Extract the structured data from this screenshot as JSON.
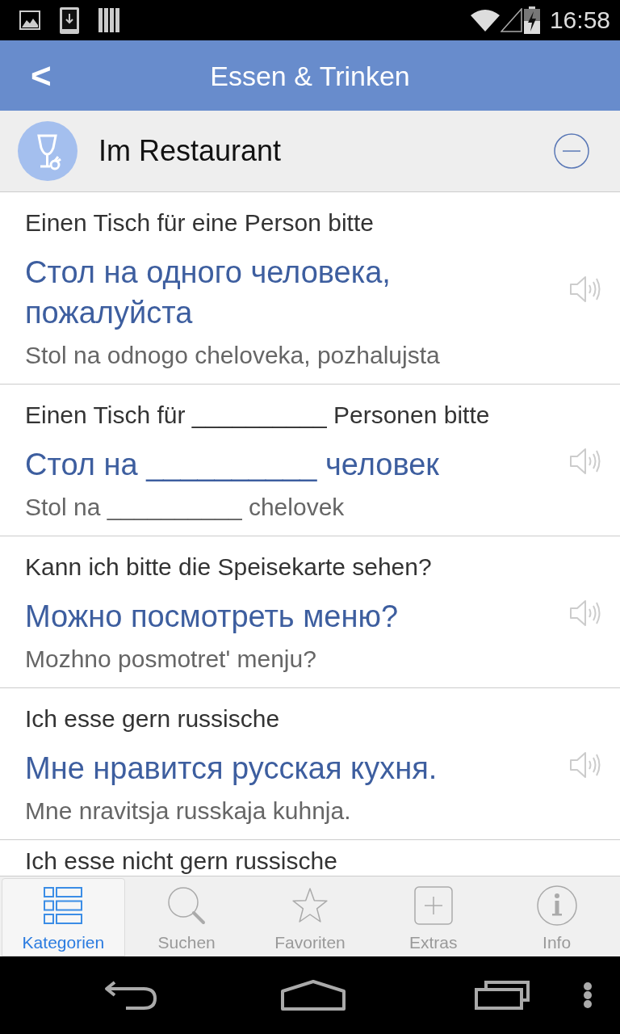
{
  "status_bar": {
    "time": "16:58"
  },
  "header": {
    "back_label": "<",
    "title": "Essen & Trinken"
  },
  "category": {
    "title": "Im Restaurant",
    "expanded": true
  },
  "phrases": [
    {
      "german": "Einen Tisch für eine Person bitte",
      "russian": "Стол на одного человека, пожалуйста",
      "transliteration": "Stol na odnogo cheloveka, pozhalujsta"
    },
    {
      "german": "Einen Tisch für __________ Personen bitte",
      "russian": "Стол на __________ человек",
      "transliteration": "Stol na __________ chelovek"
    },
    {
      "german": "Kann ich bitte die Speisekarte sehen?",
      "russian": "Можно посмотреть меню?",
      "transliteration": "Mozhno posmotretʹ menju?"
    },
    {
      "german": "Ich esse gern russische",
      "russian": "Мне нравится русская кухня.",
      "transliteration": "Mne nravitsja russkaja kuhnja."
    },
    {
      "german": "Ich esse nicht gern russische"
    }
  ],
  "tabs": [
    {
      "label": "Kategorien",
      "selected": true
    },
    {
      "label": "Suchen",
      "selected": false
    },
    {
      "label": "Favoriten",
      "selected": false
    },
    {
      "label": "Extras",
      "selected": false
    },
    {
      "label": "Info",
      "selected": false
    }
  ]
}
